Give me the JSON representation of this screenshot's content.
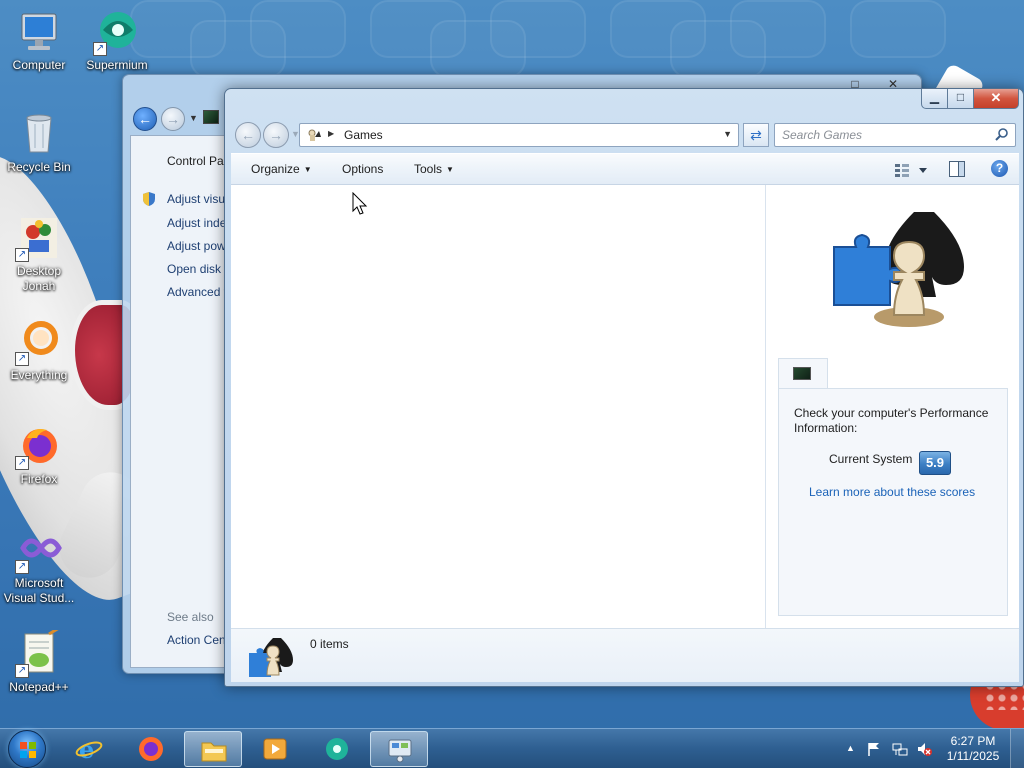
{
  "desktop": {
    "icons": [
      {
        "label": "Computer"
      },
      {
        "label": "Supermium"
      },
      {
        "label": "Recycle Bin"
      },
      {
        "label": "Desktop Jonah"
      },
      {
        "label": "Everything"
      },
      {
        "label": "Firefox"
      },
      {
        "label": "Microsoft Visual Stud..."
      },
      {
        "label": "Notepad++"
      }
    ]
  },
  "back_window": {
    "sidebar_title": "Control Pane",
    "items": [
      "Adjust visua",
      "Adjust index",
      "Adjust powe",
      "Open disk cl",
      "Advanced to"
    ],
    "see_also": "See also",
    "action_center": "Action Cent"
  },
  "window": {
    "address": {
      "crumb": "Games"
    },
    "search": {
      "placeholder": "Search Games"
    },
    "toolbar": {
      "organize": "Organize",
      "options": "Options",
      "tools": "Tools"
    },
    "preview": {
      "perf_text": "Check your computer's Performance Information:",
      "current_label": "Current System",
      "score": "5.9",
      "learn_link": "Learn more about these scores"
    },
    "status": {
      "items": "0 items"
    }
  },
  "taskbar": {
    "clock_time": "6:27 PM",
    "clock_date": "1/11/2025"
  },
  "colors": {
    "accent": "#1b63b8",
    "close_button": "#c5402a",
    "desktop": "#3f7fbd",
    "taskbar": "#2e5f91",
    "score_badge": "#3c7fc4"
  },
  "icons": {
    "computer": "monitor-icon",
    "supermium": "supermium-browser-icon",
    "recycle": "recycle-bin-icon",
    "firefox": "firefox-icon",
    "everything": "everything-search-icon",
    "vs": "visual-studio-icon",
    "notepad": "notepad-plus-plus-icon",
    "games": "chess-puzzle-games-icon"
  }
}
